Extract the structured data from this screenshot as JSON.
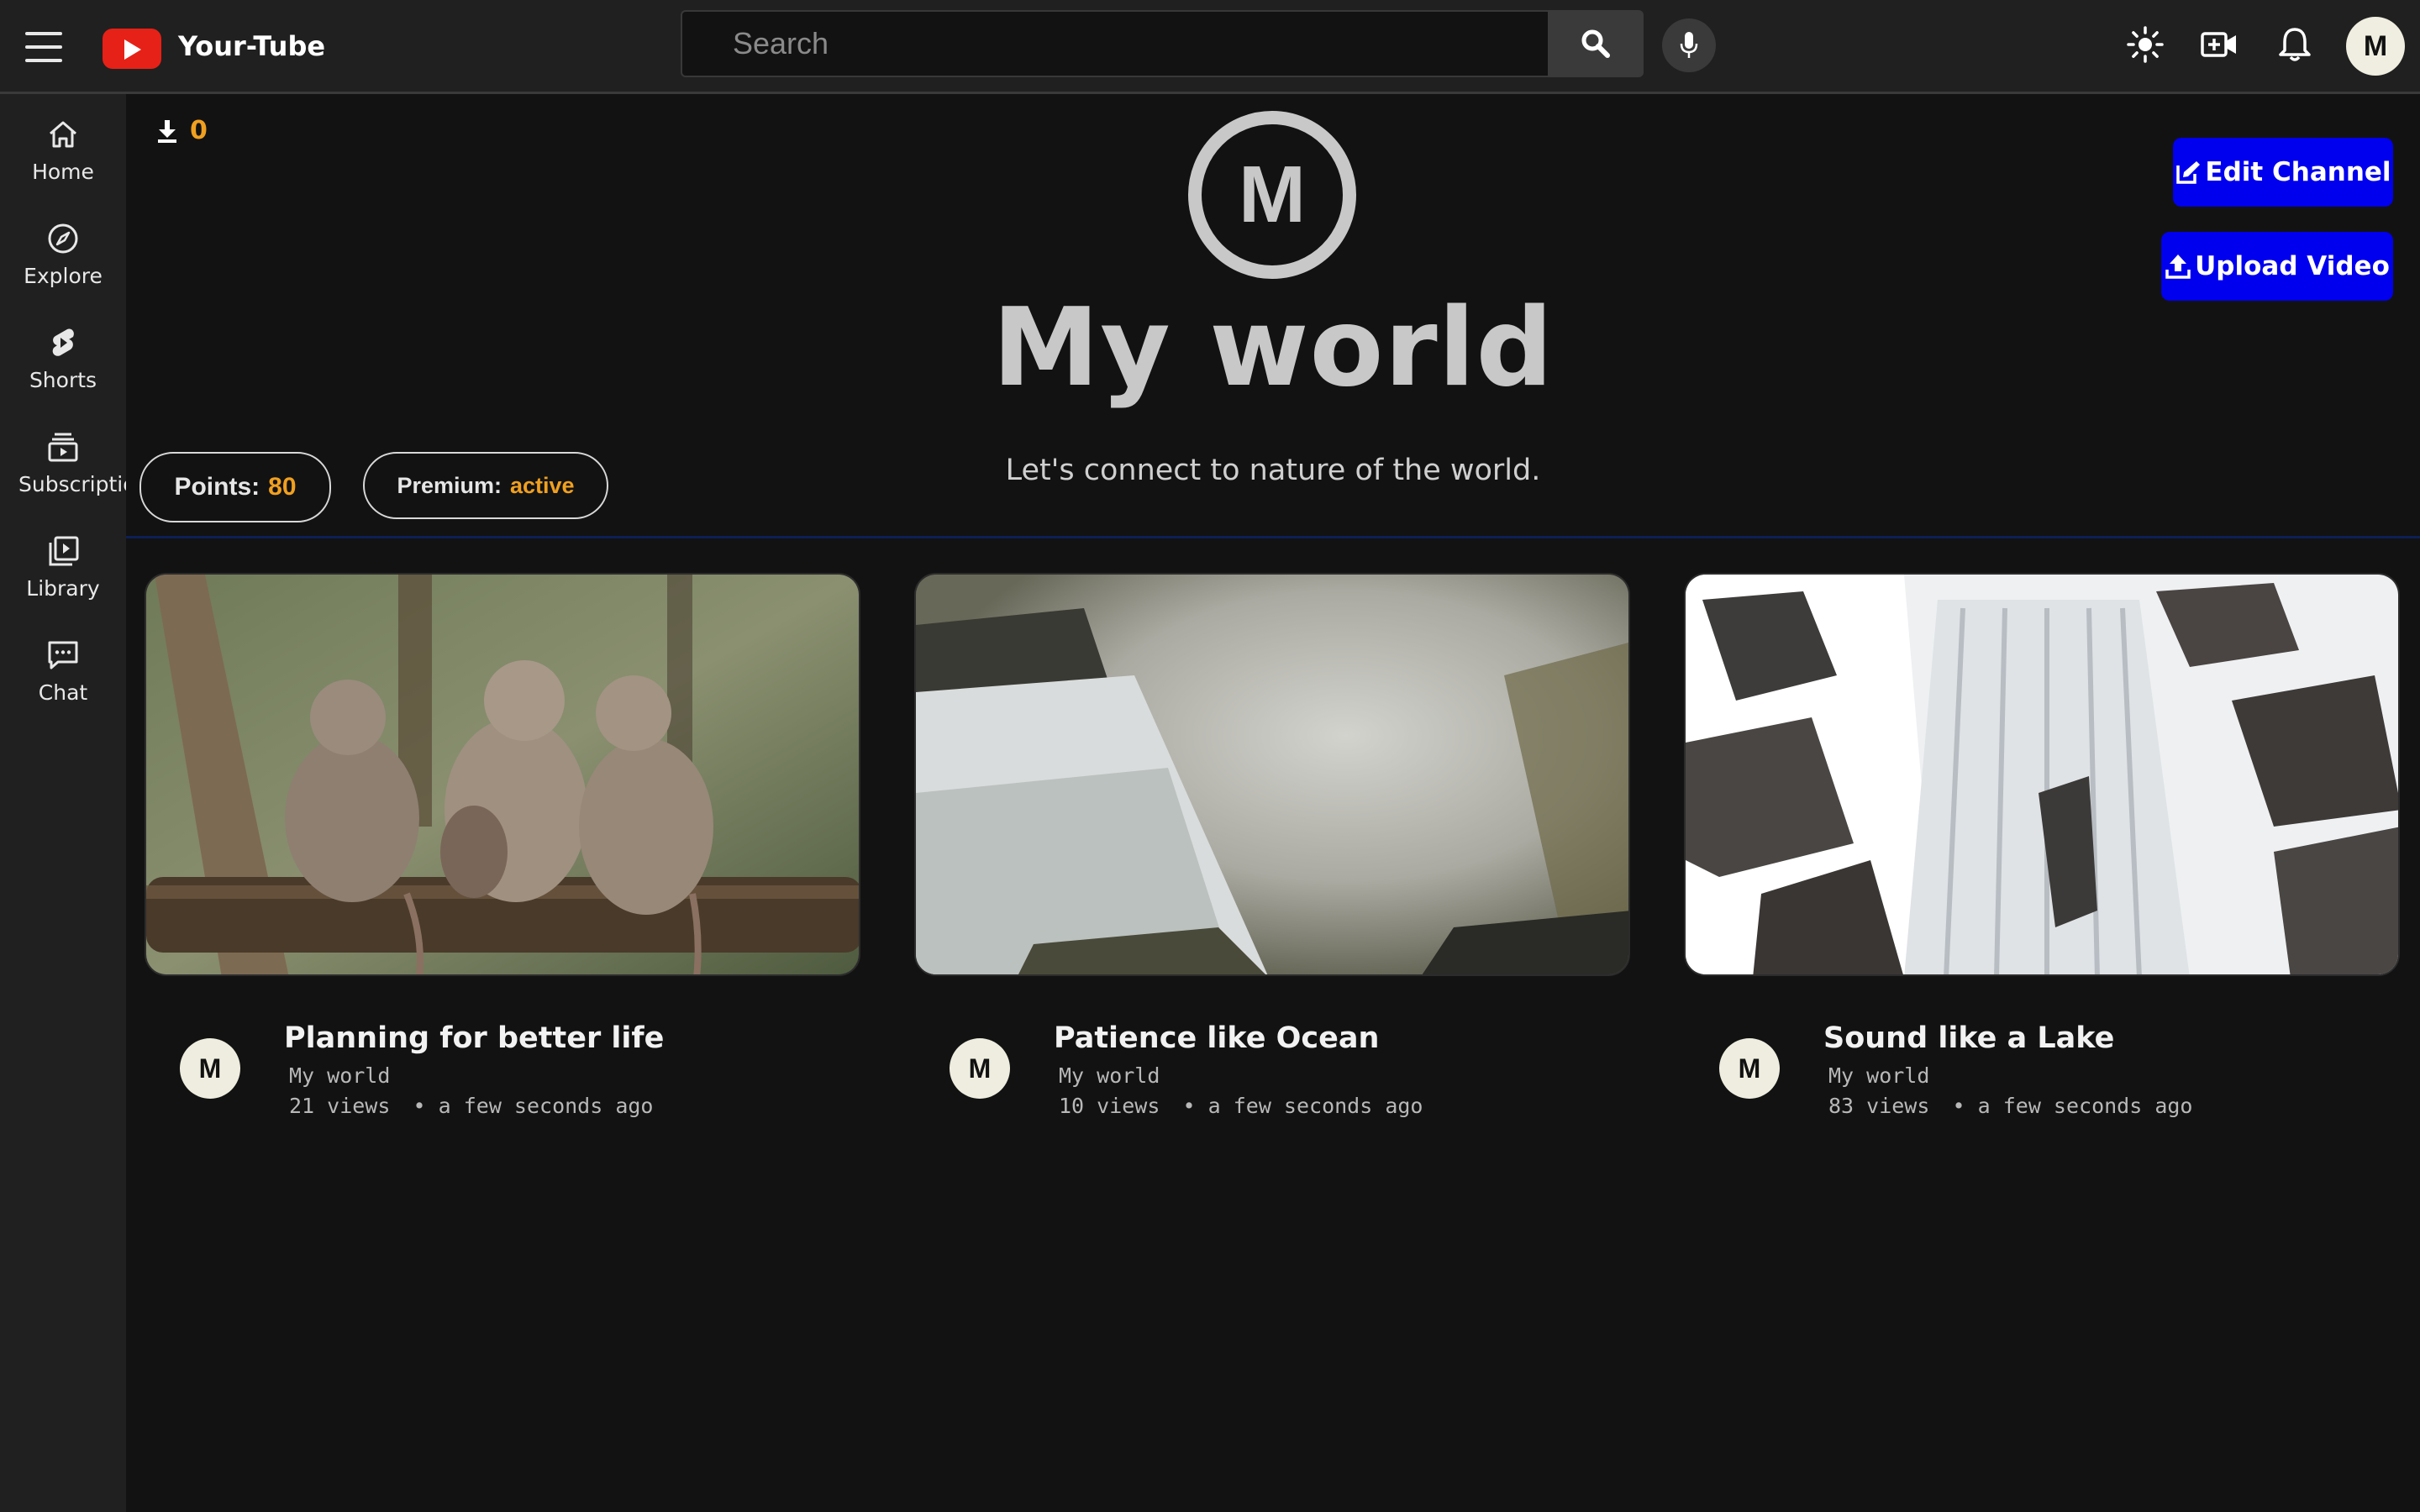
{
  "app": {
    "brand": "Your-Tube"
  },
  "topbar": {
    "search_placeholder": "Search",
    "icons": [
      "menu-icon",
      "logo-icon",
      "search-icon",
      "mic-icon",
      "theme-icon",
      "create-video-icon",
      "bell-icon"
    ],
    "avatar_letter": "M"
  },
  "sidebar": {
    "items": [
      {
        "label": "Home",
        "icon": "home-icon"
      },
      {
        "label": "Explore",
        "icon": "compass-icon"
      },
      {
        "label": "Shorts",
        "icon": "shorts-icon"
      },
      {
        "label": "Subscriptions",
        "icon": "subscriptions-icon"
      },
      {
        "label": "Library",
        "icon": "library-icon"
      },
      {
        "label": "Chat",
        "icon": "chat-icon"
      }
    ]
  },
  "channel": {
    "downloads_count": "0",
    "avatar_letter": "M",
    "title": "My world",
    "description": "Let's connect to nature of the world.",
    "points_label": "Points:",
    "points_value": "80",
    "premium_label": "Premium:",
    "premium_value": "active",
    "edit_button": "Edit Channel",
    "upload_button": "Upload Video"
  },
  "videos": [
    {
      "title": "Planning for better life",
      "channel": "My world",
      "views": "21 views",
      "time": "a few seconds ago",
      "avatar_letter": "M",
      "thumbnail": "baboons-on-log"
    },
    {
      "title": "Patience like Ocean",
      "channel": "My world",
      "views": "10 views",
      "time": "a few seconds ago",
      "avatar_letter": "M",
      "thumbnail": "waterfall-mist"
    },
    {
      "title": "Sound like a Lake",
      "channel": "My world",
      "views": "83 views",
      "time": "a few seconds ago",
      "avatar_letter": "M",
      "thumbnail": "snowy-waterfall"
    }
  ],
  "colors": {
    "accent": "#0000ee",
    "highlight": "#f0a020",
    "background": "#121212",
    "panel": "#202020"
  }
}
